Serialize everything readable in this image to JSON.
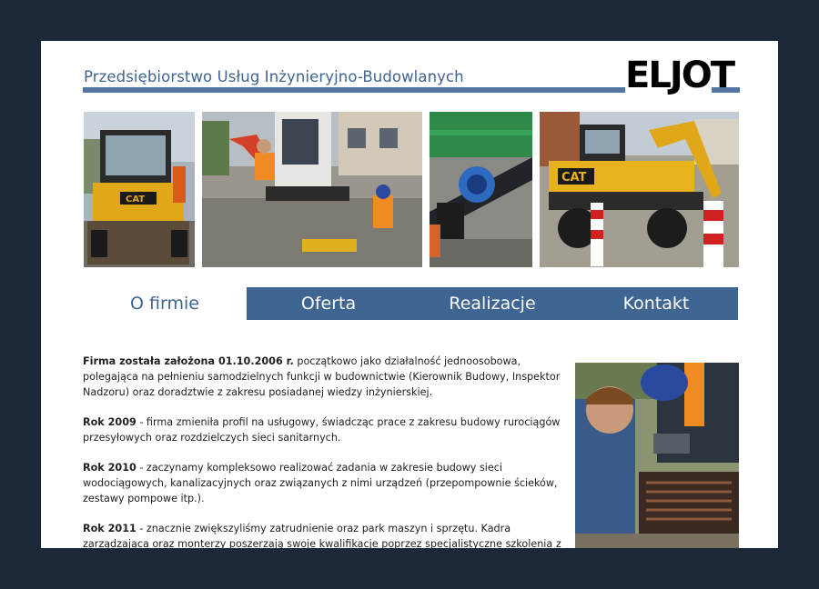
{
  "header": {
    "company_name": "Przedsiębiorstwo Usług Inżynieryjno-Budowlanych",
    "logo_text": "ELJOT"
  },
  "nav": {
    "items": [
      {
        "label": "O firmie"
      },
      {
        "label": "Oferta"
      },
      {
        "label": "Realizacje"
      },
      {
        "label": "Kontakt"
      }
    ],
    "active_index": 0
  },
  "content": {
    "paragraphs": [
      {
        "bold": "Firma została założona 01.10.2006 r.",
        "text": " początkowo jako działalność jednoosobowa, polegająca na pełnieniu samodzielnych funkcji w budownictwie (Kierownik Budowy, Inspektor Nadzoru) oraz doradztwie z zakresu posiadanej wiedzy inżynierskiej."
      },
      {
        "bold": "Rok 2009",
        "text": " - firma zmieniła profil na usługowy, świadcząc prace z zakresu budowy rurociągów przesyłowych oraz rozdzielczych sieci sanitarnych."
      },
      {
        "bold": "Rok 2010",
        "text": " - zaczynamy kompleksowo realizować zadania w zakresie budowy sieci wodociągowych, kanalizacyjnych oraz związanych z nimi urządzeń (przepompownie ścieków, zestawy pompowe itp.)."
      },
      {
        "bold": "Rok 2011",
        "text": " - znacznie zwiększyliśmy zatrudnienie oraz park maszyn i sprzętu. Kadra zarządzająca oraz monterzy poszerzają swoje kwalifikacje poprzez specjalistyczne szkolenia z zakresu nowych technologii oraz przepisów. Rozpoczęliśmy regularną współpracę z jednostkami samorządu"
      }
    ]
  },
  "colors": {
    "brand_blue": "#3f6593",
    "frame": "#1c2838",
    "cat_yellow": "#e8b21c"
  },
  "photos": [
    {
      "icon": "backhoe-loader-photo"
    },
    {
      "icon": "excavator-workers-photo"
    },
    {
      "icon": "pipe-fitting-photo"
    },
    {
      "icon": "cat-excavator-photo"
    },
    {
      "icon": "workers-drain-photo"
    }
  ]
}
